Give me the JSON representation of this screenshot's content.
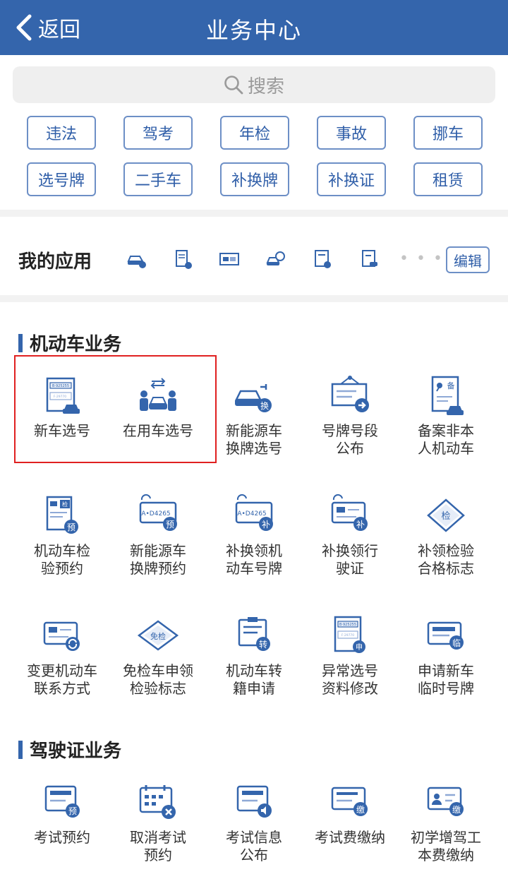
{
  "header": {
    "back_label": "返回",
    "title": "业务中心"
  },
  "search": {
    "placeholder": "搜索"
  },
  "tags": [
    "违法",
    "驾考",
    "年检",
    "事故",
    "挪车",
    "选号牌",
    "二手车",
    "补换牌",
    "补换证",
    "租赁"
  ],
  "my_apps": {
    "title": "我的应用",
    "more": "• • •",
    "edit_label": "编辑"
  },
  "vehicle_section": {
    "title": "机动车业务",
    "items": [
      {
        "label": "新车选号",
        "icon": "plate-car-icon",
        "highlighted": true
      },
      {
        "label": "在用车选号",
        "icon": "people-car-icon",
        "highlighted": true
      },
      {
        "label": "新能源车\n换牌选号",
        "icon": "ev-car-icon"
      },
      {
        "label": "号牌号段\n公布",
        "icon": "notice-board-icon"
      },
      {
        "label": "备案非本\n人机动车",
        "icon": "record-doc-icon"
      },
      {
        "label": "机动车检\n验预约",
        "icon": "inspection-reserve-icon"
      },
      {
        "label": "新能源车\n换牌预约",
        "icon": "plate-reserve-icon"
      },
      {
        "label": "补换领机\n动车号牌",
        "icon": "plate-replace-icon"
      },
      {
        "label": "补换领行\n驶证",
        "icon": "license-replace-icon"
      },
      {
        "label": "补领检验\n合格标志",
        "icon": "inspection-badge-icon"
      },
      {
        "label": "变更机动车\n联系方式",
        "icon": "contact-change-icon"
      },
      {
        "label": "免检车申领\n检验标志",
        "icon": "exempt-badge-icon"
      },
      {
        "label": "机动车转\n籍申请",
        "icon": "transfer-doc-icon"
      },
      {
        "label": "异常选号\n资料修改",
        "icon": "plate-edit-icon"
      },
      {
        "label": "申请新车\n临时号牌",
        "icon": "temp-plate-icon"
      }
    ]
  },
  "plate_texts": {
    "a": "A•D4265",
    "b": "B·925255",
    "c": "F·29770"
  },
  "badge_texts": {
    "huan": "换",
    "yu": "预",
    "bu": "补",
    "jian": "检",
    "mianjian": "免检",
    "zhuan": "转",
    "shen": "申",
    "lin": "临",
    "jiao": "缴",
    "bei": "备"
  },
  "license_section": {
    "title": "驾驶证业务",
    "items": [
      {
        "label": "考试预约",
        "icon": "exam-reserve-icon"
      },
      {
        "label": "取消考试\n预约",
        "icon": "cancel-exam-icon"
      },
      {
        "label": "考试信息\n公布",
        "icon": "exam-info-icon"
      },
      {
        "label": "考试费缴纳",
        "icon": "exam-fee-icon"
      },
      {
        "label": "初学增驾工\n本费缴纳",
        "icon": "learner-fee-icon"
      }
    ]
  },
  "colors": {
    "brand": "#3465ac",
    "accent": "#2f5ea8",
    "highlight": "#e02020"
  }
}
